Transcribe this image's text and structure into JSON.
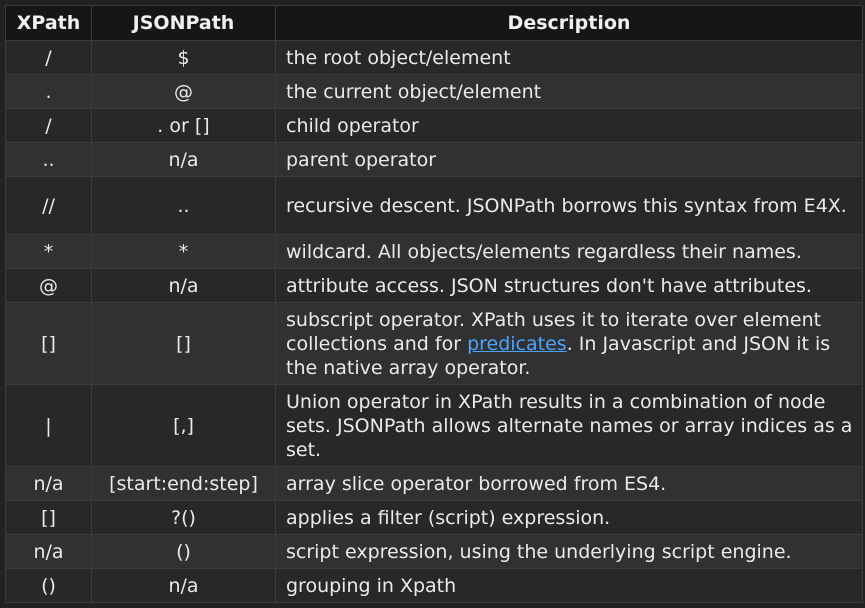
{
  "table": {
    "headers": [
      "XPath",
      "JSONPath",
      "Description"
    ],
    "rows": [
      {
        "xpath": "/",
        "jsonpath": "$",
        "desc": "the root object/element"
      },
      {
        "xpath": ".",
        "jsonpath": "@",
        "desc": "the current object/element"
      },
      {
        "xpath": "/",
        "jsonpath": ". or []",
        "desc": "child operator"
      },
      {
        "xpath": "..",
        "jsonpath": "n/a",
        "desc": "parent operator"
      },
      {
        "xpath": "//",
        "jsonpath": "..",
        "desc": "recursive descent. JSONPath borrows this syntax from E4X."
      },
      {
        "xpath": "*",
        "jsonpath": "*",
        "desc": "wildcard. All objects/elements regardless their names."
      },
      {
        "xpath": "@",
        "jsonpath": "n/a",
        "desc": "attribute access. JSON structures don't have attributes."
      },
      {
        "xpath": "[]",
        "jsonpath": "[]",
        "desc_before": "subscript operator. XPath uses it to iterate over element collections and for ",
        "desc_link": "predicates",
        "desc_after": ". In Javascript and JSON it is the native array operator."
      },
      {
        "xpath": "|",
        "jsonpath": "[,]",
        "desc": "Union operator in XPath results in a combination of node sets. JSONPath allows alternate names or array indices as a set."
      },
      {
        "xpath": "n/a",
        "jsonpath": "[start:end:step]",
        "desc": "array slice operator borrowed from ES4."
      },
      {
        "xpath": "[]",
        "jsonpath": "?()",
        "desc": "applies a filter (script) expression."
      },
      {
        "xpath": "n/a",
        "jsonpath": "()",
        "desc": "script expression, using the underlying script engine."
      },
      {
        "xpath": "()",
        "jsonpath": "n/a",
        "desc": "grouping in Xpath"
      }
    ]
  },
  "colors": {
    "background": "#222222",
    "header_bg": "#161616",
    "row_odd": "#282828",
    "row_even": "#313131",
    "border": "#3c3c3c",
    "text": "#eaeaea",
    "link": "#4aa3ff"
  }
}
